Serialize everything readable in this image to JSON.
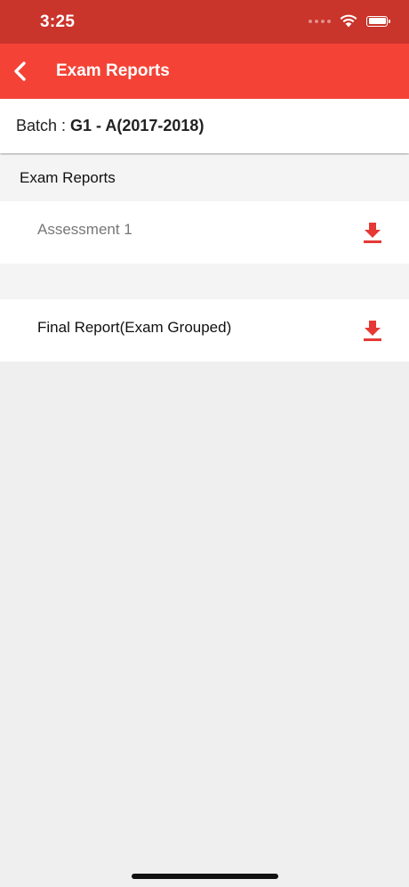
{
  "status_bar": {
    "time": "3:25"
  },
  "app_bar": {
    "title": "Exam Reports"
  },
  "batch": {
    "label": "Batch :",
    "value": "G1 - A(2017-2018)"
  },
  "section": {
    "title": "Exam Reports"
  },
  "reports": [
    {
      "label": "Assessment 1",
      "icon": "download-icon"
    },
    {
      "label": "Final Report(Exam Grouped)",
      "icon": "download-icon"
    }
  ],
  "colors": {
    "status_bar": "#c9342b",
    "app_bar": "#f44336",
    "accent": "#e53935",
    "background": "#efefef"
  }
}
